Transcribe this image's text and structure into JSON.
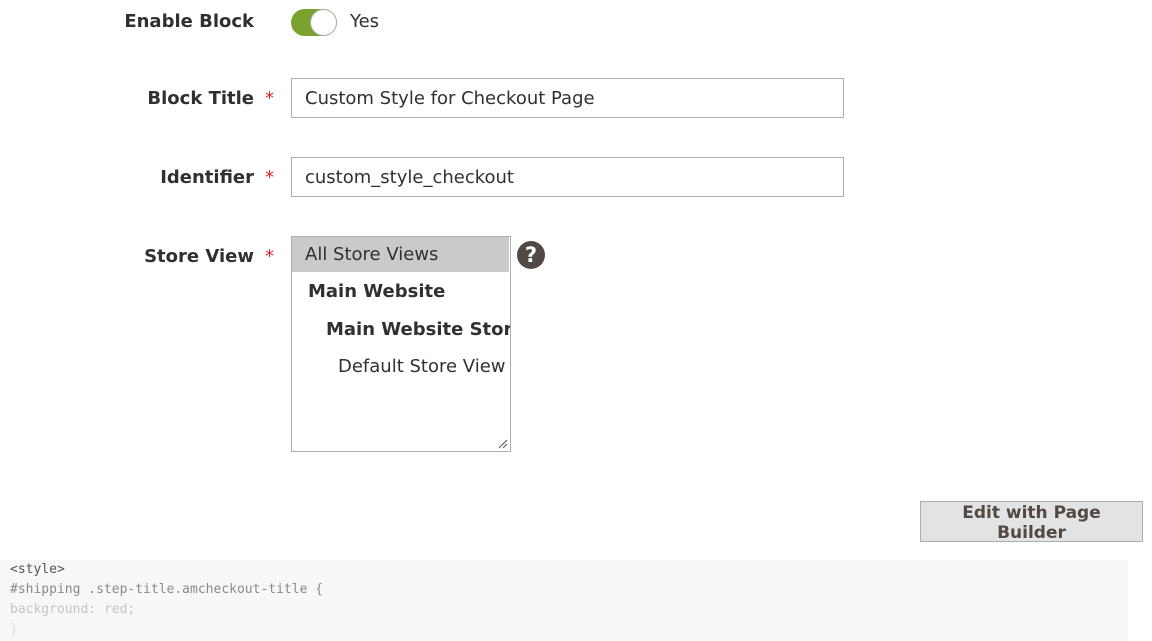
{
  "enable_block": {
    "label": "Enable Block",
    "value_text": "Yes",
    "enabled": true,
    "toggle_color": "#79a22e"
  },
  "block_title": {
    "label": "Block Title",
    "required_mark": "*",
    "value": "Custom Style for Checkout Page"
  },
  "identifier": {
    "label": "Identifier",
    "required_mark": "*",
    "value": "custom_style_checkout"
  },
  "store_view": {
    "label": "Store View",
    "required_mark": "*",
    "options": [
      {
        "label": "All Store Views",
        "selected": true
      },
      {
        "label": "Main Website",
        "selected": false
      },
      {
        "label": "Main Website Store",
        "selected": false
      },
      {
        "label": "Default Store View",
        "selected": false
      }
    ],
    "help_icon": "?"
  },
  "page_builder_button": {
    "label": "Edit with Page Builder"
  },
  "code": {
    "lines": [
      "<style>",
      "#shipping .step-title.amcheckout-title {",
      "background: red;",
      "}"
    ]
  },
  "colors": {
    "required": "#e22626",
    "selected_option_bg": "#cacaca",
    "help_icon_bg": "#514943"
  }
}
